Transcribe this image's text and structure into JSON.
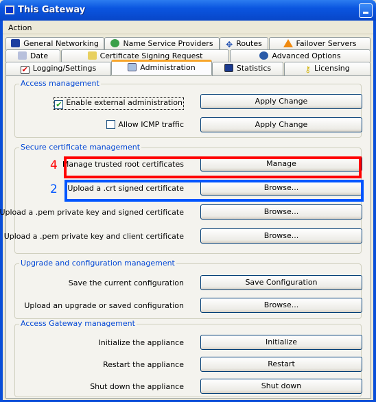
{
  "window": {
    "title": "This Gateway"
  },
  "menu": {
    "action": "Action"
  },
  "tabs": {
    "row1": [
      {
        "label": "General Networking",
        "icon": "monitor-icon"
      },
      {
        "label": "Name Service Providers",
        "icon": "globe-network-icon"
      },
      {
        "label": "Routes",
        "icon": "move-arrows-icon"
      },
      {
        "label": "Failover Servers",
        "icon": "warning-cone-icon"
      }
    ],
    "row2": [
      {
        "label": "Date",
        "icon": "calendar-icon"
      },
      {
        "label": "Certificate Signing Request",
        "icon": "certificate-lock-icon"
      },
      {
        "label": "Advanced Options",
        "icon": "globe-document-icon"
      }
    ],
    "row3": [
      {
        "label": "Logging/Settings",
        "icon": "checkmark-icon"
      },
      {
        "label": "Administration",
        "icon": "admin-magnifier-icon",
        "selected": true
      },
      {
        "label": "Statistics",
        "icon": "chart-monitor-icon"
      },
      {
        "label": "Licensing",
        "icon": "key-icon"
      }
    ]
  },
  "groups": {
    "access": {
      "title": "Access management",
      "rows": [
        {
          "label": "Enable external administration",
          "checked": true,
          "button": "Apply Change"
        },
        {
          "label": "Allow ICMP traffic",
          "checked": false,
          "button": "Apply Change"
        }
      ]
    },
    "certs": {
      "title": "Secure certificate management",
      "rows": [
        {
          "label": "Manage trusted root certificates",
          "button": "Manage",
          "annotation": "4"
        },
        {
          "label": "Upload a .crt signed certificate",
          "button": "Browse...",
          "annotation": "2"
        },
        {
          "label": "Upload a .pem private key and signed certificate",
          "button": "Browse..."
        },
        {
          "label": "Upload a .pem private key and client certificate",
          "button": "Browse..."
        }
      ]
    },
    "upgrade": {
      "title": "Upgrade and configuration management",
      "rows": [
        {
          "label": "Save the current configuration",
          "button": "Save Configuration"
        },
        {
          "label": "Upload an upgrade or saved configuration",
          "button": "Browse..."
        }
      ]
    },
    "gateway": {
      "title": "Access Gateway management",
      "rows": [
        {
          "label": "Initialize the appliance",
          "button": "Initialize"
        },
        {
          "label": "Restart the appliance",
          "button": "Restart"
        },
        {
          "label": "Shut down the appliance",
          "button": "Shut down"
        }
      ]
    }
  },
  "colors": {
    "annotation_red": "#ff0000",
    "annotation_blue": "#0055ff",
    "group_title": "#0046d5",
    "selected_tab_accent": "#f7a52c"
  }
}
